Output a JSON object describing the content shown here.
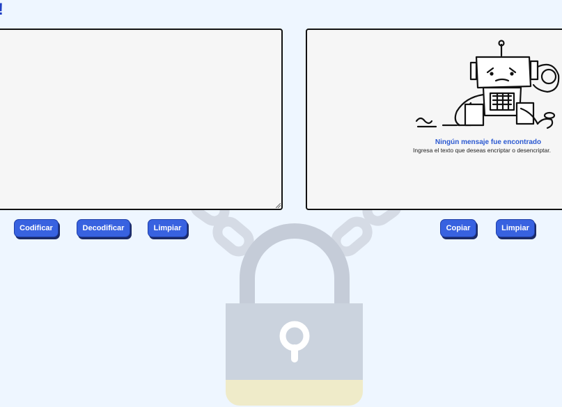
{
  "header": {
    "title": "!"
  },
  "output_panel": {
    "empty_title": "Ningún mensaje fue encontrado",
    "empty_subtitle": "Ingresa el texto que deseas encriptar o desencriptar."
  },
  "actions": {
    "encode_label": "Codificar",
    "decode_label": "Decodificar",
    "clear_input_label": "Limpiar",
    "copy_label": "Copiar",
    "clear_output_label": "Limpiar"
  },
  "colors": {
    "background": "#eef6ff",
    "button": "#3862e0",
    "button_shadow": "#1c2b66",
    "accent_text": "#2b59d1"
  },
  "icons": {
    "background_illustration": "padlock-with-chains",
    "empty_state_illustration": "sad-robot"
  }
}
